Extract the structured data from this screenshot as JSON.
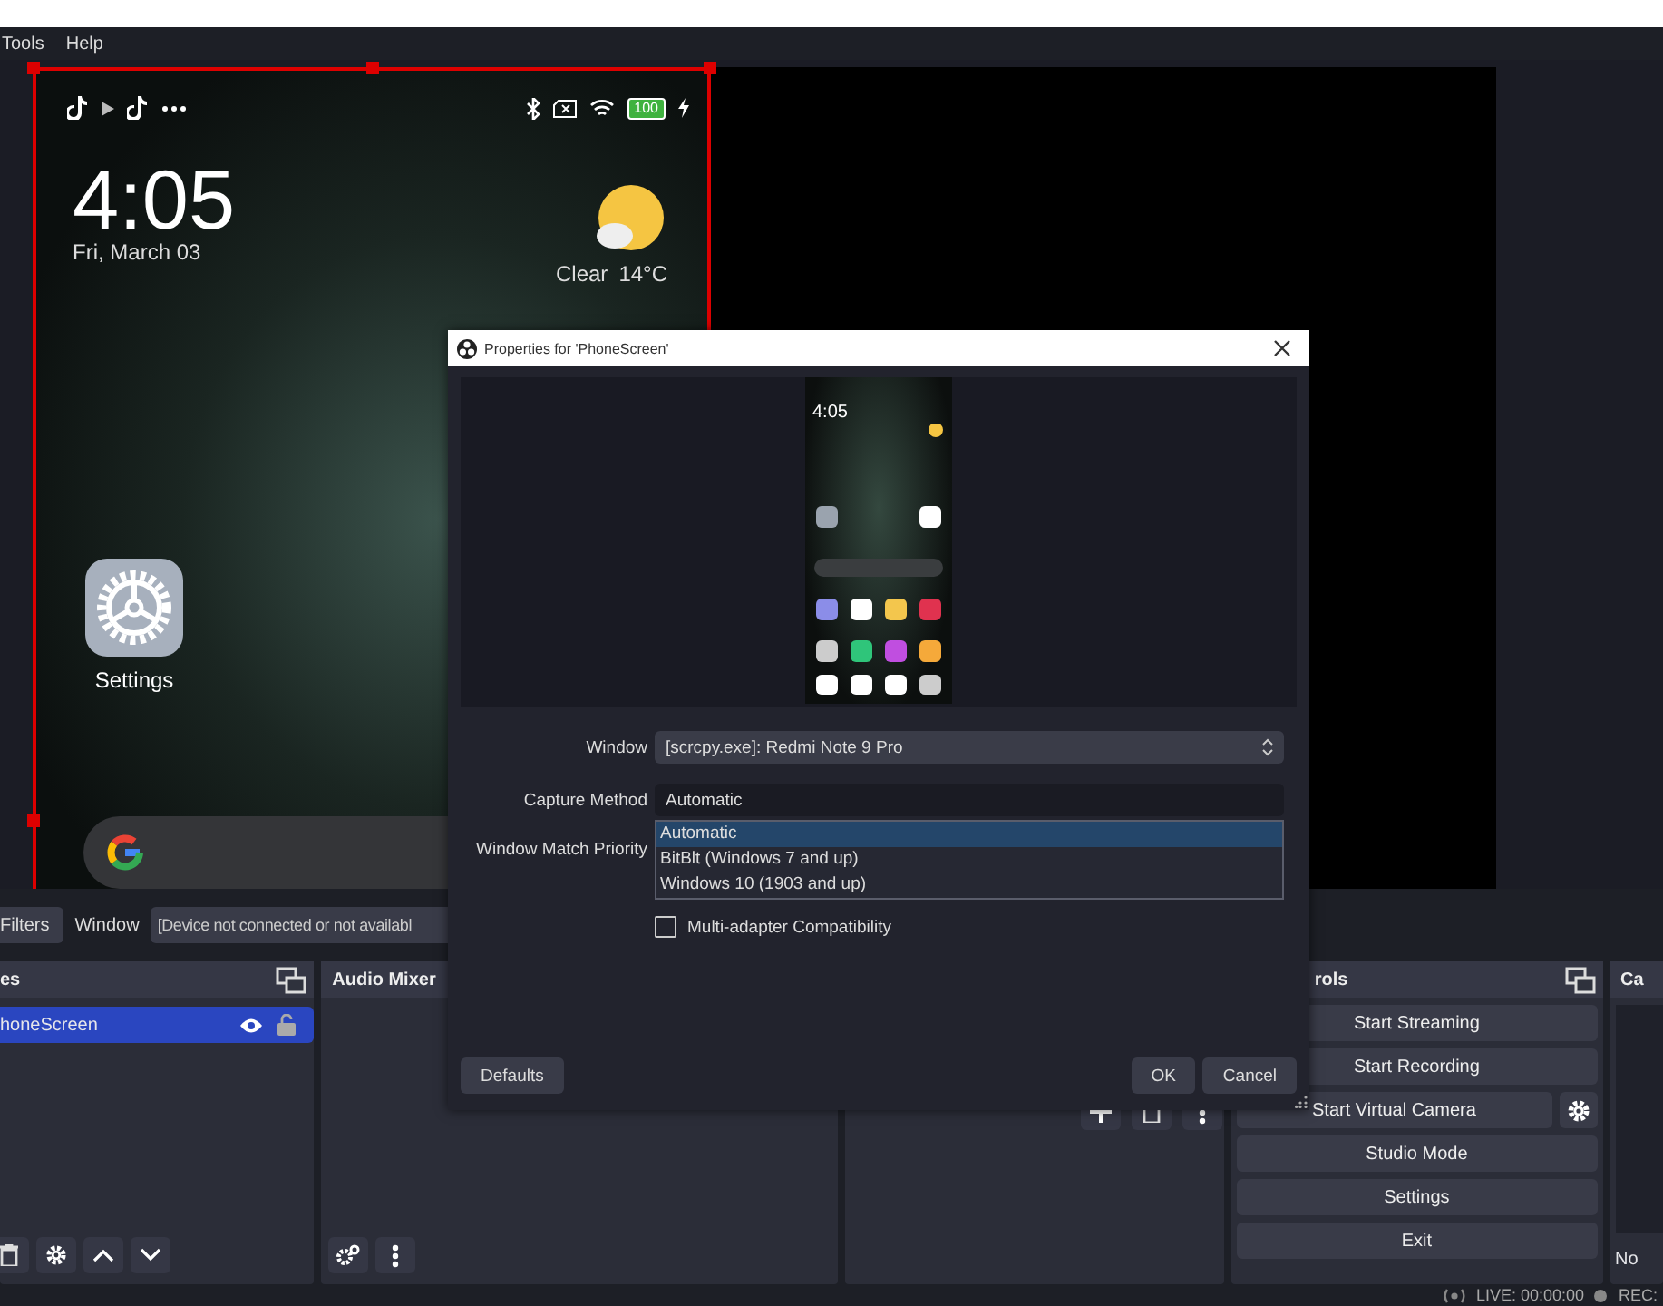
{
  "menu": [
    "Tools",
    "Help"
  ],
  "preview": {
    "phone": {
      "time": "4:05",
      "date": "Fri, March 03",
      "weather": "Clear",
      "temperature": "14°C",
      "battery": "100",
      "app_label": "Settings"
    }
  },
  "toolbar": {
    "filters_button": "Filters",
    "window_label": "Window",
    "window_value": "[Device not connected or not availabl"
  },
  "sources": {
    "title": "es",
    "items": [
      {
        "name": "honeScreen",
        "selected": true
      }
    ]
  },
  "audio_mixer": {
    "title": "Audio Mixer"
  },
  "controls": {
    "title": "rols",
    "buttons": [
      {
        "label": "Start Streaming",
        "kind": "plain"
      },
      {
        "label": "Start Recording",
        "kind": "plain"
      },
      {
        "label": "Start Virtual Camera",
        "kind": "gear"
      },
      {
        "label": "Studio Mode",
        "kind": "plain"
      },
      {
        "label": "Settings",
        "kind": "plain"
      },
      {
        "label": "Exit",
        "kind": "plain"
      }
    ]
  },
  "cut_dock": {
    "title": "Ca",
    "text": "No"
  },
  "status_bar": {
    "live": "LIVE: 00:00:00",
    "rec": "REC:"
  },
  "dialog": {
    "title": "Properties for 'PhoneScreen'",
    "thumbnail_time": "4:05",
    "fields": [
      {
        "label": "Window",
        "value": "[scrcpy.exe]: Redmi Note 9 Pro",
        "focused": false
      },
      {
        "label": "Capture Method",
        "value": "Automatic",
        "focused": true
      },
      {
        "label": "Window Match Priority"
      }
    ],
    "dropdown_options": [
      {
        "label": "Automatic",
        "selected": true
      },
      {
        "label": "BitBlt (Windows 7 and up)",
        "selected": false
      },
      {
        "label": "Windows 10 (1903 and up)",
        "selected": false
      }
    ],
    "checkboxes": [
      {
        "label": "Multi-adapter Compatibility",
        "checked": false
      }
    ],
    "defaults_button": "Defaults",
    "ok_button": "OK",
    "cancel_button": "Cancel"
  }
}
